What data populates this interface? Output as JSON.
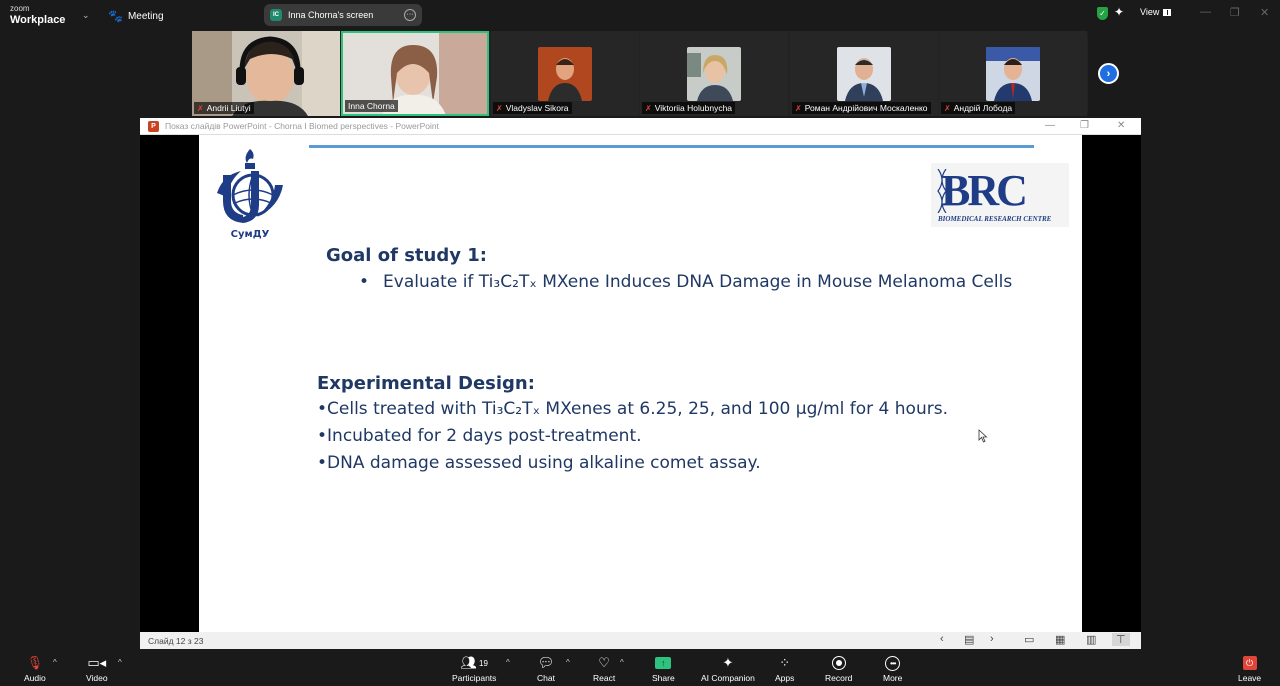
{
  "app": {
    "brand_top": "zoom",
    "brand_bottom": "Workplace",
    "meeting_label": "Meeting"
  },
  "screen_share": {
    "initials": "IC",
    "label": "Inna Chorna's screen"
  },
  "top_right": {
    "view_label": "View"
  },
  "participants_gallery": [
    {
      "name": "Andrii Liutyi",
      "muted": true
    },
    {
      "name": "Inna Chorna",
      "muted": false,
      "active": true
    },
    {
      "name": "Vladyslav Sikora",
      "muted": true
    },
    {
      "name": "Viktoriia Holubnycha",
      "muted": true
    },
    {
      "name": "Роман Андрійович Москаленко",
      "muted": true
    },
    {
      "name": "Андрій Лобода",
      "muted": true
    }
  ],
  "ppt_window": {
    "title": "Показ слайдів PowerPoint  -  Chorna I Biomed perspectives - PowerPoint",
    "icon_letter": "P",
    "status": "Слайд 12 з 23"
  },
  "slide": {
    "sumdu_caption": "СумДУ",
    "brc_logo": "BRC",
    "brc_subtitle": "BIOMEDICAL RESEARCH CENTRE",
    "goal_heading": "Goal of study 1:",
    "goal_bullet": "Evaluate if Ti₃C₂Tₓ MXene Induces DNA Damage in Mouse Melanoma Cells",
    "design_heading": "Experimental Design:",
    "design_items": [
      "•Cells treated with Ti₃C₂Tₓ MXenes at 6.25, 25, and 100 µg/ml for 4 hours.",
      "•Incubated for 2 days post-treatment.",
      "•DNA damage assessed using alkaline comet assay."
    ]
  },
  "toolbar": {
    "audio": "Audio",
    "video": "Video",
    "participants": "Participants",
    "participants_count": "19",
    "chat": "Chat",
    "react": "React",
    "share": "Share",
    "ai_companion": "AI Companion",
    "apps": "Apps",
    "record": "Record",
    "more": "More",
    "leave": "Leave"
  }
}
